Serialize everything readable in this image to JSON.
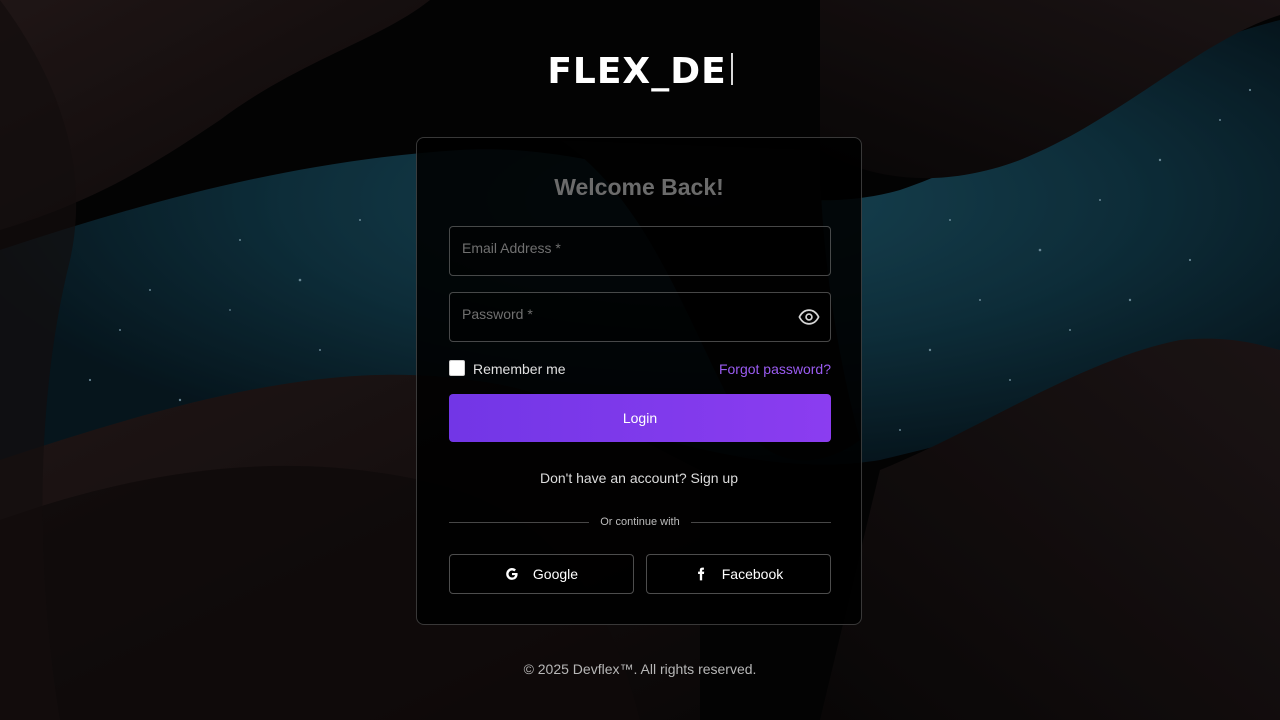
{
  "brand": {
    "title": "FLEX_DE"
  },
  "login_card": {
    "heading": "Welcome Back!",
    "email": {
      "label": "Email Address *",
      "value": ""
    },
    "password": {
      "label": "Password *",
      "value": "",
      "toggle_icon": "eye-icon"
    },
    "remember_label": "Remember me",
    "remember_checked": false,
    "forgot_label": "Forgot password?",
    "login_label": "Login",
    "signup_text": "Don't have an account? Sign up",
    "divider_text": "Or continue with",
    "social": {
      "google_label": "Google",
      "google_icon": "google-icon",
      "facebook_label": "Facebook",
      "facebook_icon": "facebook-icon"
    }
  },
  "footer": {
    "text": "© 2025 Devflex™. All rights reserved."
  },
  "colors": {
    "accent": "#7c3aed",
    "forgot_link": "#9b5cf2",
    "card_background": "#000000"
  }
}
